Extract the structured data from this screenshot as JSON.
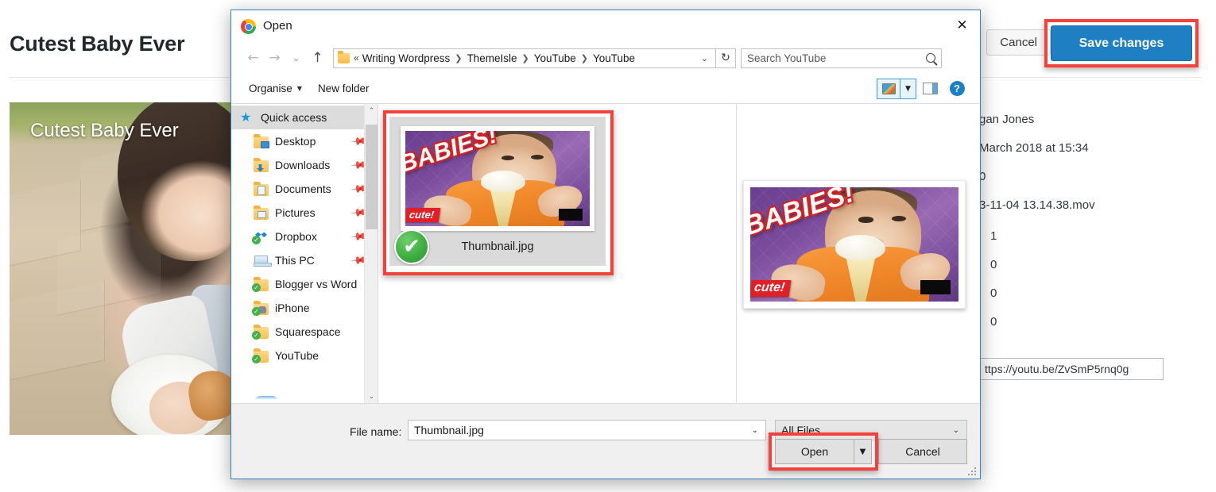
{
  "background_page": {
    "page_title": "Cutest Baby Ever",
    "video_overlay_title": "Cutest Baby Ever",
    "top_buttons": {
      "cancel_label": "Cancel",
      "save_label": "Save changes",
      "save_color": "#1e7fc2",
      "highlight_color": "#f4423a"
    },
    "detail_rows": [
      {
        "text": "gan Jones"
      },
      {
        "text": "March 2018 at 15:34"
      },
      {
        "text": "0"
      },
      {
        "text": "3-11-04 13.14.38.mov"
      },
      {
        "text": "1"
      },
      {
        "text": "0"
      },
      {
        "text": "0"
      },
      {
        "text": "0"
      }
    ],
    "url_field_value": "ttps://youtu.be/ZvSmP5rnq0g"
  },
  "dialog": {
    "title": "Open",
    "app_icon": "chrome-icon",
    "close_icon": "✕",
    "nav": {
      "back_icon": "←",
      "forward_icon": "→",
      "recent_icon": "⌄",
      "up_icon": "↑",
      "breadcrumb_prefix": "«",
      "breadcrumb": [
        "Writing Wordpress",
        "ThemeIsle",
        "YouTube",
        "YouTube"
      ],
      "breadcrumb_separator": "❯",
      "breadcrumb_dropdown_icon": "⌄",
      "refresh_icon": "↻",
      "search_placeholder": "Search YouTube",
      "search_value": "",
      "search_icon": "search-icon"
    },
    "toolbar": {
      "organise_label": "Organise",
      "organise_caret": "▼",
      "new_folder_label": "New folder",
      "view_options_icon": "view-options-icon",
      "view_caret": "▼",
      "preview_pane_icon": "preview-pane-icon",
      "help_label": "?"
    },
    "nav_pane": {
      "items": [
        {
          "label": "Quick access",
          "icon": "star-icon",
          "selected": true,
          "indent": false,
          "pinned": false,
          "synced": false
        },
        {
          "label": "Desktop",
          "icon": "folder-desktop-icon",
          "selected": false,
          "indent": true,
          "pinned": true,
          "synced": false
        },
        {
          "label": "Downloads",
          "icon": "folder-downloads-icon",
          "selected": false,
          "indent": true,
          "pinned": true,
          "synced": false
        },
        {
          "label": "Documents",
          "icon": "folder-documents-icon",
          "selected": false,
          "indent": true,
          "pinned": true,
          "synced": false
        },
        {
          "label": "Pictures",
          "icon": "folder-pictures-icon",
          "selected": false,
          "indent": true,
          "pinned": true,
          "synced": false
        },
        {
          "label": "Dropbox",
          "icon": "dropbox-icon",
          "selected": false,
          "indent": true,
          "pinned": true,
          "synced": true
        },
        {
          "label": "This PC",
          "icon": "this-pc-icon",
          "selected": false,
          "indent": true,
          "pinned": true,
          "synced": false
        },
        {
          "label": "Blogger vs Word",
          "icon": "folder-icon",
          "selected": false,
          "indent": true,
          "pinned": false,
          "synced": true
        },
        {
          "label": "iPhone",
          "icon": "folder-users-icon",
          "selected": false,
          "indent": true,
          "pinned": false,
          "synced": true
        },
        {
          "label": "Squarespace",
          "icon": "folder-icon",
          "selected": false,
          "indent": true,
          "pinned": false,
          "synced": true
        },
        {
          "label": "YouTube",
          "icon": "folder-icon",
          "selected": false,
          "indent": true,
          "pinned": false,
          "synced": true
        }
      ],
      "scroll_up_icon": "⌃",
      "scroll_down_icon": "⌄"
    },
    "file_list": {
      "files": [
        {
          "name": "Thumbnail.jpg",
          "selected": true,
          "check_icon": "✔",
          "thumb": {
            "headline": "BABIES!",
            "badge": "cute!"
          }
        }
      ]
    },
    "preview": {
      "headline": "BABIES!",
      "badge": "cute!"
    },
    "footer": {
      "file_name_label": "File name:",
      "file_name_value": "Thumbnail.jpg",
      "file_name_caret": "⌄",
      "file_type_value": "All Files",
      "file_type_caret": "⌄",
      "open_label": "Open",
      "open_split_caret": "▼",
      "cancel_label": "Cancel"
    }
  }
}
